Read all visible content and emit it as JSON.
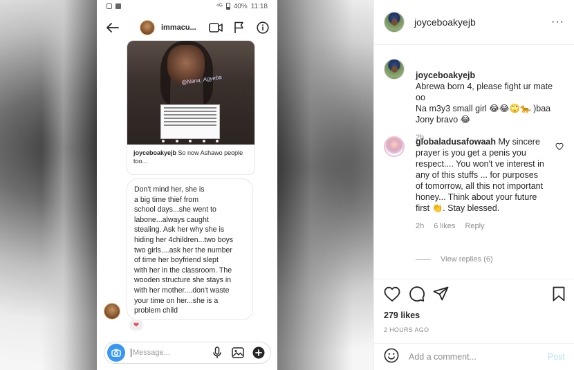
{
  "phone": {
    "status": {
      "signal": "⁴ᴳ",
      "battery": "40%",
      "time": "11:18"
    },
    "dm_header": {
      "name": "immacu..."
    },
    "shared_post": {
      "caption_user": "joyceboakyejb",
      "caption_text": "So now Ashawo people too...",
      "watermark": "@Nana_Agyeba"
    },
    "message": "Don't mind her, she is\na big time thief from\nschool days...she went to\nlabone...always caught\nstealing. Ask her why she is\nhiding her 4children...two boys\ntwo girls....ask her the number\nof time her boyfriend slept\nwith her in the classroom. The\nwooden structure she stays in\nwith her mother....don't waste\nyour time on her...she is a\nproblem child",
    "reaction": "❤",
    "composer": {
      "placeholder": "Message..."
    }
  },
  "panel": {
    "header": {
      "username": "joyceboakyejb",
      "more": "···"
    },
    "comments": [
      {
        "username": "joyceboakyejb",
        "text": "Abrewa born 4, please fight ur mate oo\nNa m3y3 small girl 😂😂🙄🐆 )baa Jony bravo 😂",
        "time": "2h"
      },
      {
        "username": "globaladusafowaah",
        "text": "My sincere prayer is you get a penis you respect.... You won't ve interest in any of this stuffs ... for purposes of tomorrow, all this not important honey... Think about your future first 👏. Stay blessed.",
        "time": "2h",
        "likes": "6 likes",
        "reply": "Reply",
        "view_replies": "View replies (6)"
      }
    ],
    "likes": "279 likes",
    "time_ago": "2 HOURS AGO",
    "add_comment": {
      "placeholder": "Add a comment...",
      "post": "Post"
    }
  },
  "colors": {
    "accent": "#3897f0",
    "post_disabled": "#b2dffc",
    "heart": "#ed4956"
  },
  "icons": [
    "back-arrow-icon",
    "video-call-icon",
    "flag-icon",
    "info-icon",
    "camera-icon",
    "microphone-icon",
    "gallery-icon",
    "plus-circle-icon",
    "heart-icon",
    "comment-icon",
    "share-icon",
    "bookmark-icon",
    "emoji-icon"
  ]
}
